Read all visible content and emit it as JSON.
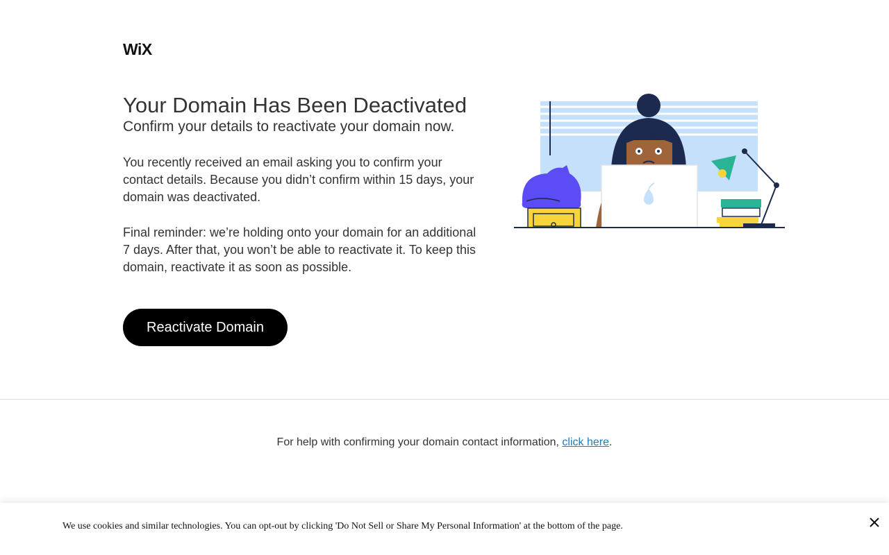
{
  "brand": {
    "logo_text": "WiX"
  },
  "main": {
    "title": "Your Domain Has Been Deactivated",
    "subtitle": "Confirm your details to reactivate your domain now.",
    "paragraph_1": "You recently received an email asking you to confirm your contact details. Because you didn’t confirm within 15 days, your domain was deactivated.",
    "paragraph_2": "Final reminder: we’re holding onto your domain for an additional 7 days. After that, you won’t be able to reactivate it. To keep this domain, reactivate it as soon as possible.",
    "cta_label": "Reactivate Domain"
  },
  "illustration": {
    "icon": "person-at-laptop-illustration"
  },
  "footer": {
    "help_text": "For help with confirming your domain contact information, ",
    "help_link": "click here",
    "help_suffix": "."
  },
  "cookie_banner": {
    "text": "We use cookies and similar technologies. You can opt-out by clicking 'Do Not Sell or Share My Personal Information' at the bottom of the page.",
    "close_icon": "close-icon"
  },
  "colors": {
    "button_bg": "#000000",
    "link": "#1a7fb5",
    "illustration_blue": "#c5e0fb",
    "cat_purple": "#5b4cf5",
    "navy": "#1b2a4e",
    "yellow": "#f7d33c",
    "green": "#2bb396"
  }
}
